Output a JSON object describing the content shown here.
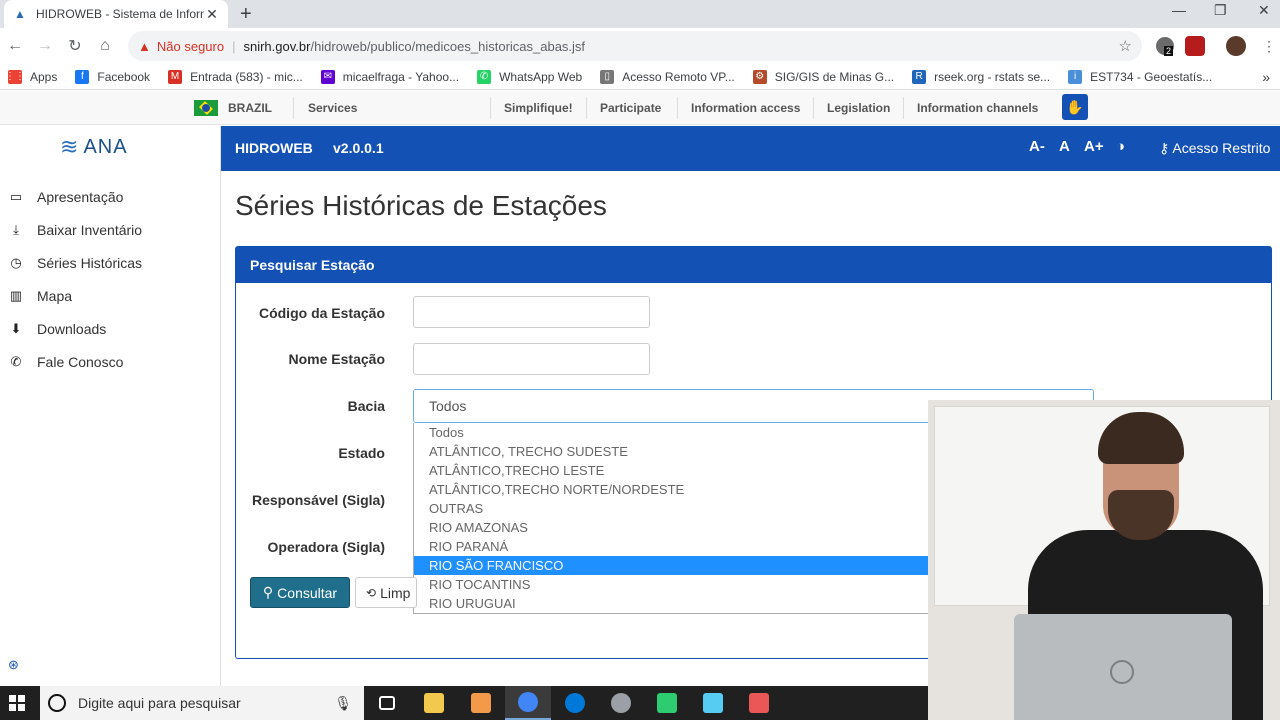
{
  "browser": {
    "tab_title": "HIDROWEB - Sistema de Informa",
    "tab_close": "✕",
    "new_tab": "+",
    "window_controls": [
      "—",
      "❐",
      "✕"
    ],
    "insecure_label": "Não seguro",
    "url_host": "snirh.gov.br",
    "url_path": "/hidroweb/publico/medicoes_historicas_abas.jsf",
    "ext_badge": "2",
    "bookmarks": [
      {
        "label": "Apps",
        "color": "#ea4335",
        "glyph": "⋮⋮"
      },
      {
        "label": "Facebook",
        "color": "#1877f2",
        "glyph": "f"
      },
      {
        "label": "Entrada (583) - mic...",
        "color": "#d93025",
        "glyph": "M"
      },
      {
        "label": "micaelfraga - Yahoo...",
        "color": "#6001d2",
        "glyph": "✉"
      },
      {
        "label": "WhatsApp Web",
        "color": "#25d366",
        "glyph": "✆"
      },
      {
        "label": "Acesso Remoto VP...",
        "color": "#777777",
        "glyph": "▯"
      },
      {
        "label": "SIG/GIS de Minas G...",
        "color": "#b44a2c",
        "glyph": "⚙"
      },
      {
        "label": "rseek.org - rstats se...",
        "color": "#2266bb",
        "glyph": "R"
      },
      {
        "label": "EST734 - Geoestatís...",
        "color": "#4a90d9",
        "glyph": "i"
      }
    ]
  },
  "govbar": {
    "country": "BRAZIL",
    "services": "Services",
    "links": [
      "Simplifique!",
      "Participate",
      "Information access",
      "Legislation",
      "Information channels"
    ]
  },
  "sidebar": {
    "logo": "ANA",
    "items": [
      {
        "label": "Apresentação",
        "icon": "tv-icon",
        "glyph": "▭"
      },
      {
        "label": "Baixar Inventário",
        "icon": "download-icon",
        "glyph": "⤓"
      },
      {
        "label": "Séries Históricas",
        "icon": "clock-icon",
        "glyph": "◷"
      },
      {
        "label": "Mapa",
        "icon": "map-icon",
        "glyph": "▥"
      },
      {
        "label": "Downloads",
        "icon": "downloads-icon",
        "glyph": "⬇"
      },
      {
        "label": "Fale Conosco",
        "icon": "phone-icon",
        "glyph": "✆"
      }
    ],
    "collapse_glyph": "⊛"
  },
  "header": {
    "app_name": "HIDROWEB",
    "version": "v2.0.0.1",
    "font_decrease": "A-",
    "font_normal": "A",
    "font_increase": "A+",
    "contrast_glyph": "◑",
    "restricted": "Acesso Restrito"
  },
  "main": {
    "title": "Séries Históricas de Estações",
    "panel_title": "Pesquisar Estação",
    "labels": {
      "codigo": "Código da Estação",
      "nome": "Nome Estação",
      "bacia": "Bacia",
      "estado": "Estado",
      "responsavel": "Responsável (Sigla)",
      "operadora": "Operadora (Sigla)"
    },
    "bacia_selected": "Todos",
    "bacia_options": [
      "Todos",
      "ATLÂNTICO, TRECHO SUDESTE",
      "ATLÂNTICO,TRECHO LESTE",
      "ATLÂNTICO,TRECHO NORTE/NORDESTE",
      "OUTRAS",
      "RIO AMAZONAS",
      "RIO PARANÁ",
      "RIO SÃO FRANCISCO",
      "RIO TOCANTINS",
      "RIO URUGUAI"
    ],
    "highlighted_option": "RIO SÃO FRANCISCO",
    "consultar": "Consultar",
    "limpar": "Limp"
  },
  "taskbar": {
    "search_placeholder": "Digite aqui para pesquisar",
    "apps": [
      {
        "name": "task-view",
        "color": "#ffffff"
      },
      {
        "name": "file-explorer",
        "color": "#f2c94c"
      },
      {
        "name": "calendar-app",
        "color": "#f2994a"
      },
      {
        "name": "chrome",
        "color": "#4285f4"
      },
      {
        "name": "edge",
        "color": "#0078d7"
      },
      {
        "name": "disc-app",
        "color": "#9aa0a6"
      },
      {
        "name": "grid-app",
        "color": "#2ecc71"
      },
      {
        "name": "search-app",
        "color": "#56ccf2"
      },
      {
        "name": "game-app",
        "color": "#eb5757"
      }
    ]
  },
  "colors": {
    "brand_blue": "#1351b4",
    "selection_blue": "#1e90ff",
    "button_teal": "#1f6e8c"
  }
}
